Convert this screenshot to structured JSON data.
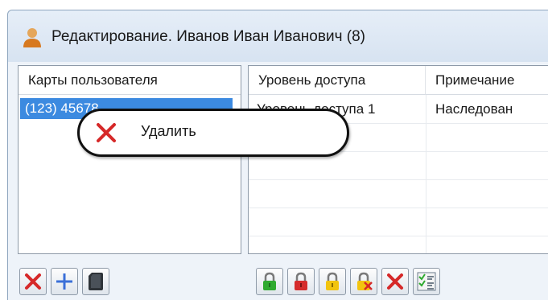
{
  "window": {
    "title": "Редактирование. Иванов Иван Иванович (8)",
    "icon": "user-icon"
  },
  "left_panel": {
    "header": "Карты пользователя",
    "rows": [
      {
        "value": "(123) 45678"
      }
    ]
  },
  "right_panel": {
    "headers": [
      "Уровень доступа",
      "Примечание"
    ],
    "rows": [
      {
        "level": "Уровень доступа 1",
        "note": "Наследован"
      }
    ]
  },
  "context_menu": {
    "items": [
      {
        "label": "Удалить",
        "icon": "delete-x-icon"
      }
    ]
  },
  "left_toolbar": {
    "buttons": [
      {
        "icon": "delete-x-icon"
      },
      {
        "icon": "add-plus-icon"
      },
      {
        "icon": "card-reader-icon"
      }
    ]
  },
  "right_toolbar": {
    "buttons": [
      {
        "icon": "green-lock-icon"
      },
      {
        "icon": "red-lock-icon"
      },
      {
        "icon": "yellow-lock-icon"
      },
      {
        "icon": "lock-remove-icon"
      },
      {
        "icon": "delete-x-icon"
      },
      {
        "icon": "checklist-icon"
      }
    ]
  },
  "colors": {
    "selection": "#3c8ae0",
    "delete_red": "#d62828",
    "add_blue": "#3a6fd8",
    "lock_green": "#2faa2f",
    "lock_red": "#d52b2b",
    "lock_yellow": "#f2c40f"
  }
}
